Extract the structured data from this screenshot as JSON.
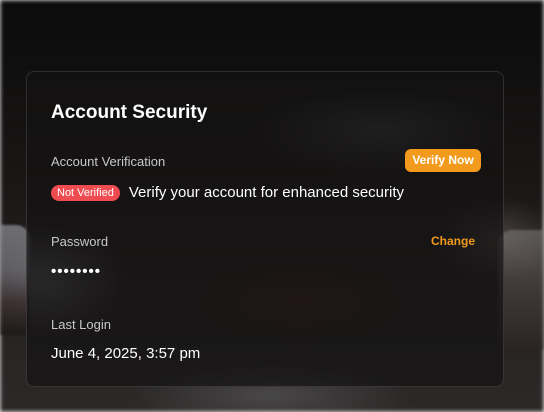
{
  "card": {
    "title": "Account Security",
    "verification": {
      "label": "Account Verification",
      "button_label": "Verify Now",
      "status_badge": "Not Verified",
      "status_text": "Verify your account for enhanced security"
    },
    "password": {
      "label": "Password",
      "change_label": "Change",
      "masked_value": "••••••••"
    },
    "last_login": {
      "label": "Last Login",
      "value": "June 4, 2025, 3:57 pm"
    }
  },
  "colors": {
    "accent": "#f29a1b",
    "danger": "#ef4c52",
    "card_background": "rgba(20,18,18,0.72)",
    "text_primary": "#ffffff",
    "text_secondary": "#c8c8c8"
  }
}
